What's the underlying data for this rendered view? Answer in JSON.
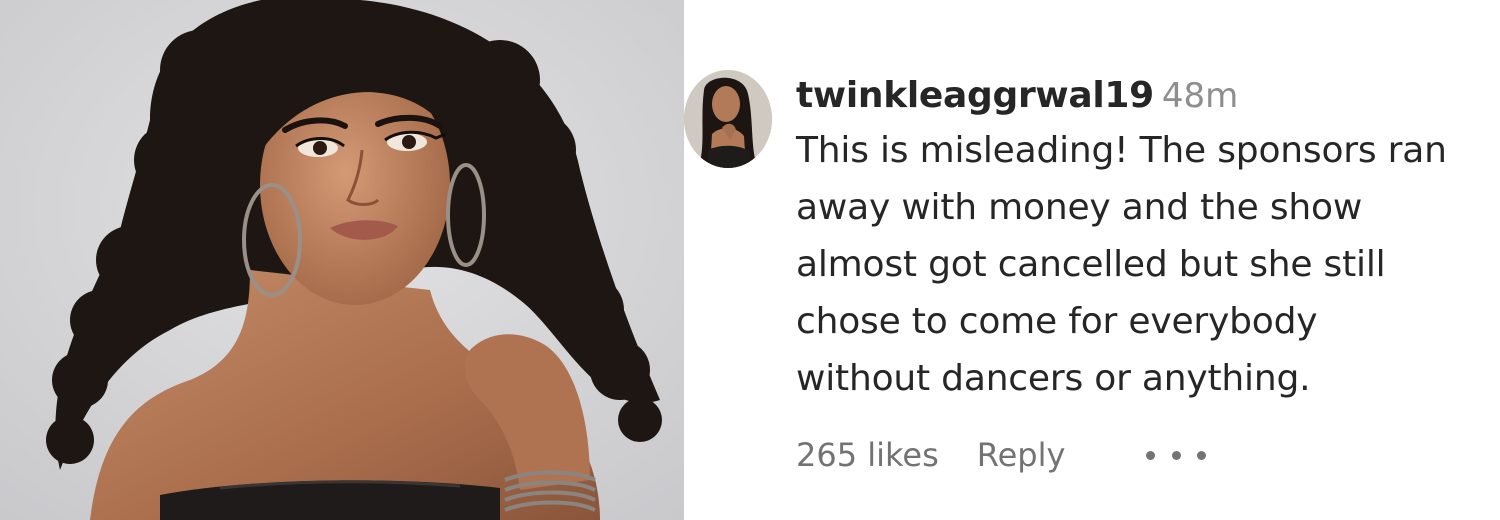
{
  "photo": {
    "icon": "portrait-photo",
    "colors": {
      "background": "#d6d6d8",
      "skin": "#b97f5e",
      "hair": "#1c1512",
      "top": "#1e1b1a"
    }
  },
  "comment": {
    "avatar_icon": "profile-avatar",
    "username": "twinkleaggrwal19",
    "timestamp": "48m",
    "lines": [
      "This is misleading! The sponsors ran",
      "away with money and the show",
      "almost got cancelled but she still",
      "chose to come for everybody",
      "without dancers or anything."
    ],
    "likes": "265 likes",
    "reply_label": "Reply",
    "more_icon": "more-options-icon"
  }
}
